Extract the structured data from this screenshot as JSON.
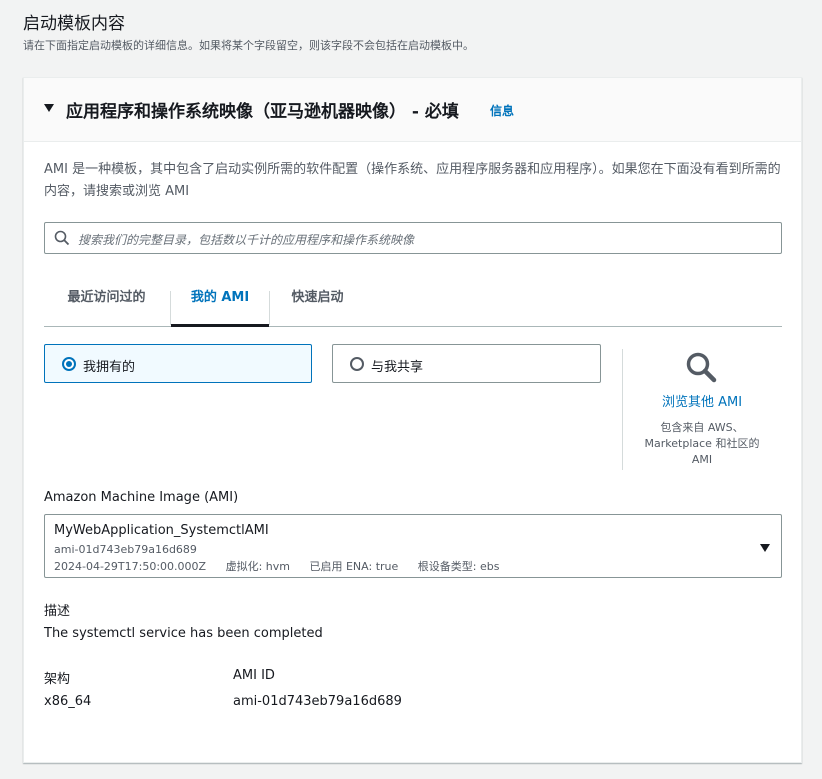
{
  "page": {
    "title": "启动模板内容",
    "description": "请在下面指定启动模板的详细信息。如果将某个字段留空，则该字段不会包括在启动模板中。"
  },
  "panel": {
    "title": "应用程序和操作系统映像（亚马逊机器映像） - 必填",
    "info_link": "信息",
    "intro": "AMI 是一种模板，其中包含了启动实例所需的软件配置（操作系统、应用程序服务器和应用程序）。如果您在下面没有看到所需的内容，请搜索或浏览 AMI",
    "search": {
      "placeholder": "搜索我们的完整目录，包括数以千计的应用程序和操作系统映像"
    },
    "tabs": [
      {
        "label": "最近访问过的",
        "active": false
      },
      {
        "label": "我的 AMI",
        "active": true
      },
      {
        "label": "快速启动",
        "active": false
      }
    ],
    "ownership": {
      "owned_by_me": "我拥有的",
      "shared_with_me": "与我共享",
      "selected": "owned_by_me"
    },
    "browse": {
      "title": "浏览其他 AMI",
      "description": "包含来自 AWS、Marketplace 和社区的 AMI"
    },
    "ami_select": {
      "label": "Amazon Machine Image (AMI)",
      "name": "MyWebApplication_SystemctlAMI",
      "id": "ami-01d743eb79a16d689",
      "created": "2024-04-29T17:50:00.000Z",
      "virtualization": "虚拟化: hvm",
      "ena": "已启用 ENA: true",
      "root_device": "根设备类型: ebs"
    },
    "details": {
      "description_label": "描述",
      "description_value": "The systemctl service has been completed",
      "arch_label": "架构",
      "arch_value": "x86_64",
      "ami_id_label": "AMI ID",
      "ami_id_value": "ami-01d743eb79a16d689"
    }
  },
  "colors": {
    "link": "#0073bb",
    "selected_bg": "#f1faff",
    "text": "#16191f",
    "muted": "#545b64"
  }
}
